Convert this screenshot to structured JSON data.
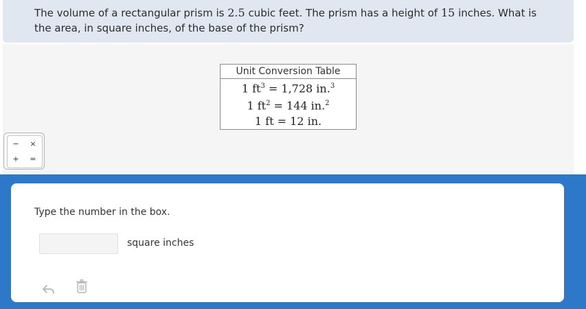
{
  "question": {
    "part1": "The volume of a rectangular prism is ",
    "volume": "2.5",
    "part2": " cubic feet. The prism has a height of ",
    "height": "15",
    "part3": " inches. What is the area, in square inches, of the base of the prism?"
  },
  "conversion_table": {
    "title": "Unit Conversion Table",
    "rows": [
      {
        "lhs": "1 ft",
        "lhs_exp": "3",
        "rhs": "1,728 in.",
        "rhs_exp": "3"
      },
      {
        "lhs": "1 ft",
        "lhs_exp": "2",
        "rhs": "144 in.",
        "rhs_exp": "2"
      },
      {
        "lhs": "1 ft",
        "lhs_exp": "",
        "rhs": "12 in.",
        "rhs_exp": ""
      }
    ]
  },
  "calculator": {
    "keys": [
      "−",
      "×",
      "+",
      "="
    ]
  },
  "answer": {
    "instruction": "Type the number in the box.",
    "input_value": "",
    "unit_label": "square inches"
  },
  "tools": {
    "undo_icon": "undo-arrow-icon",
    "delete_icon": "trash-icon"
  },
  "colors": {
    "question_bg": "#e1e7f0",
    "stage_bg": "#f5f5f5",
    "answer_section_bg": "#2e78c9",
    "icon_gray": "#b5b5b5"
  }
}
